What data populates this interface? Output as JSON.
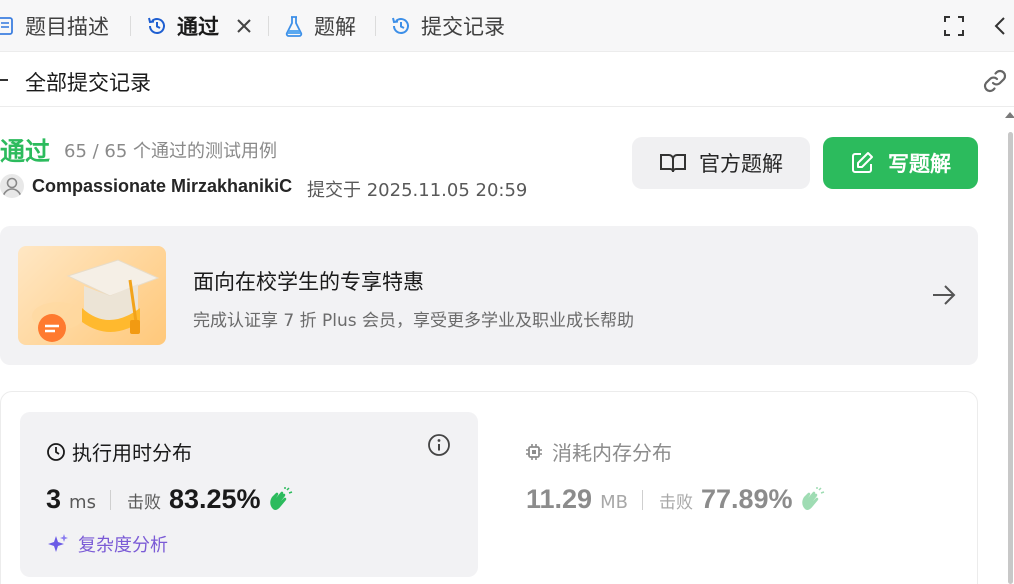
{
  "tabs": [
    {
      "label": "题目描述",
      "icon": "description-icon"
    },
    {
      "label": "通过",
      "icon": "history-icon",
      "active": true
    },
    {
      "label": "题解",
      "icon": "flask-icon"
    },
    {
      "label": "提交记录",
      "icon": "history-icon"
    }
  ],
  "subheader": {
    "title": "全部提交记录"
  },
  "result": {
    "status": "通过",
    "testcases": "65 / 65 个通过的测试用例",
    "user": "Compassionate MirzakhanikiC",
    "submitted": "提交于 2025.11.05 20:59"
  },
  "buttons": {
    "official_solution": "官方题解",
    "write_solution": "写题解"
  },
  "promo": {
    "title": "面向在校学生的专享特惠",
    "subtitle": "完成认证享 7 折 Plus 会员，享受更多学业及职业成长帮助"
  },
  "runtime": {
    "title": "执行用时分布",
    "value": "3",
    "unit": "ms",
    "beat_label": "击败",
    "beat_value": "83.25%",
    "analysis_label": "复杂度分析"
  },
  "memory": {
    "title": "消耗内存分布",
    "value": "11.29",
    "unit": "MB",
    "beat_label": "击败",
    "beat_value": "77.89%"
  },
  "colors": {
    "accent_green": "#2cbb5d",
    "analysis_purple": "#7b5bd6"
  }
}
